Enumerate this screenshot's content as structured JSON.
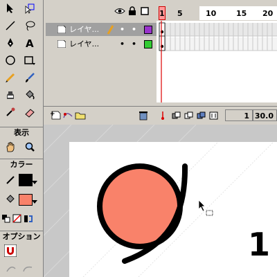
{
  "tools": {
    "view_label": "表示",
    "color_label": "カラー",
    "option_label": "オプション",
    "stroke_color": "#000000",
    "fill_color": "#f9826a"
  },
  "timeline": {
    "frame_numbers": [
      "1",
      "5",
      "10",
      "15",
      "20"
    ],
    "layers": [
      {
        "name": "レイヤ...",
        "color": "#9933cc"
      },
      {
        "name": "レイヤ...",
        "color": "#33cc33"
      }
    ],
    "current_frame": "1",
    "frame_rate": "30.0"
  },
  "stage": {
    "circle_fill": "#f9826a",
    "stroke_color": "#000000",
    "glyph": "1"
  }
}
